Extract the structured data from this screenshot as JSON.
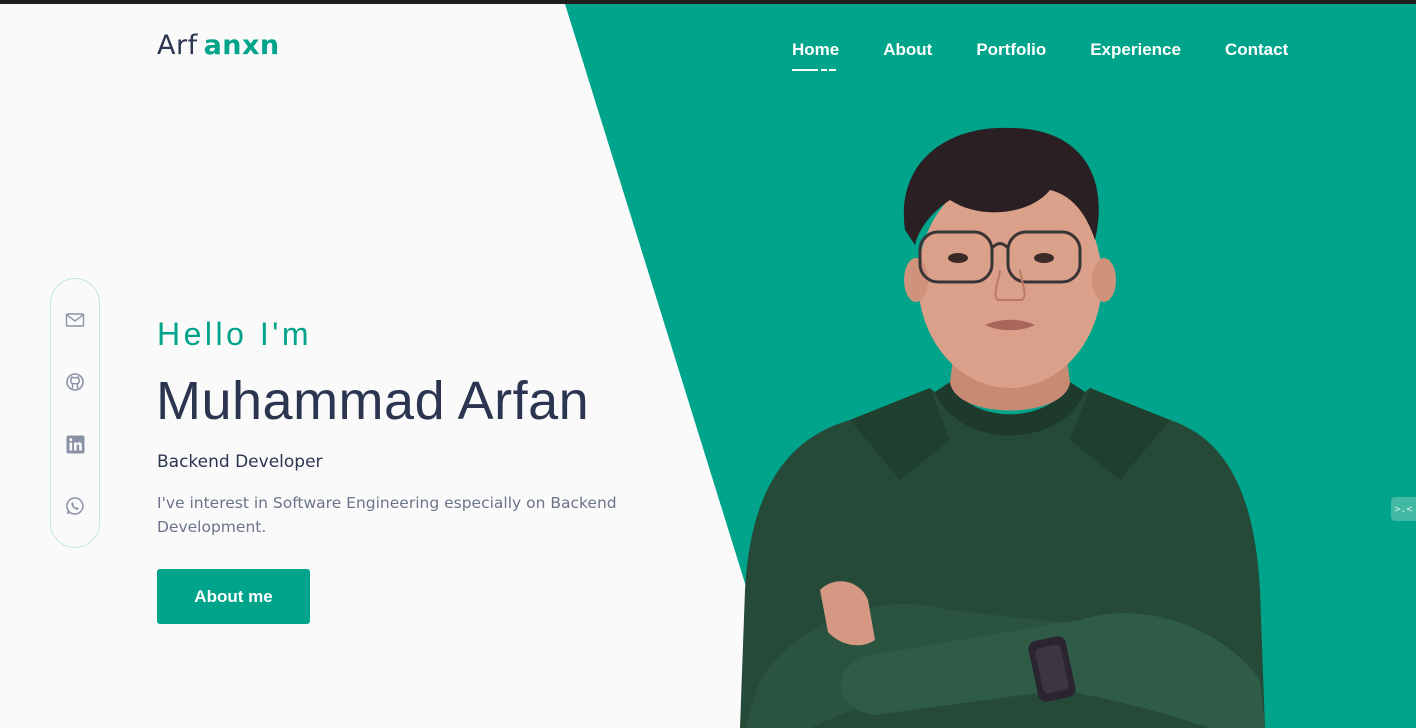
{
  "brand": {
    "part1": "Arf",
    "part2": "anxn"
  },
  "nav": {
    "items": [
      {
        "label": "Home",
        "active": true
      },
      {
        "label": "About"
      },
      {
        "label": "Portfolio"
      },
      {
        "label": "Experience"
      },
      {
        "label": "Contact"
      }
    ]
  },
  "social": {
    "icons": [
      "mail-icon",
      "github-icon",
      "linkedin-icon",
      "whatsapp-icon"
    ]
  },
  "hero": {
    "greeting": "Hello I'm",
    "name": "Muhammad Arfan",
    "role": "Backend Developer",
    "description": "I've interest in Software Engineering especially on Backend Development.",
    "cta_label": "About me"
  },
  "side_tab": {
    "label": ">.<"
  },
  "colors": {
    "accent": "#00a48a",
    "text_dark": "#2b3550",
    "text_muted": "#6b7489",
    "background": "#fafafb"
  }
}
